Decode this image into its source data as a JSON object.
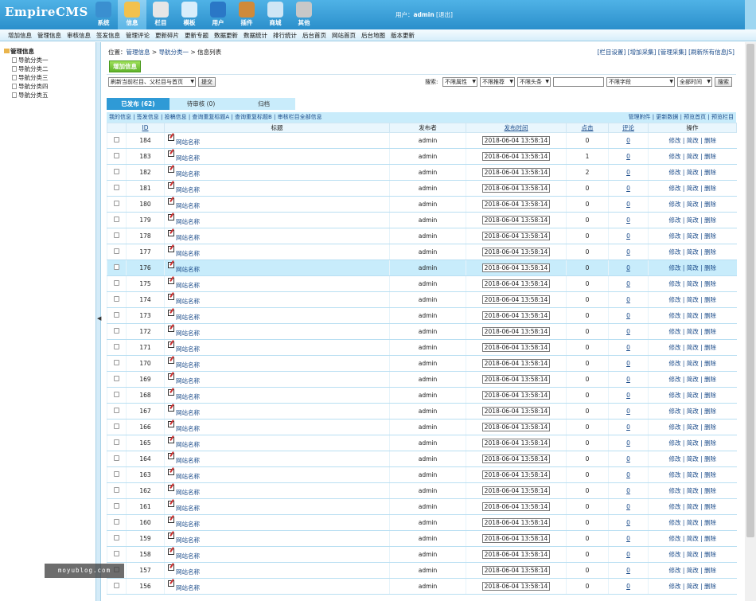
{
  "header": {
    "logo_text": "EmpireCMS",
    "nav": [
      {
        "label": "系统",
        "icon": "globe-icon",
        "color": "#3a8fd0"
      },
      {
        "label": "信息",
        "icon": "edit-note-icon",
        "color": "#f2c14e"
      },
      {
        "label": "栏目",
        "icon": "folder-icon",
        "color": "#e6e6e6"
      },
      {
        "label": "模板",
        "icon": "template-window-icon",
        "color": "#d8eefb"
      },
      {
        "label": "用户",
        "icon": "user-icon",
        "color": "#2a77c6"
      },
      {
        "label": "插件",
        "icon": "tools-icon",
        "color": "#d08a3a"
      },
      {
        "label": "商城",
        "icon": "shop-card-icon",
        "color": "#cfe6f5"
      },
      {
        "label": "其他",
        "icon": "gear-icon",
        "color": "#c8c8c8"
      }
    ],
    "active_nav": 1,
    "user_prefix": "用户：",
    "username": "admin",
    "logout": "[退出]"
  },
  "subnav": [
    "增加信息",
    "管理信息",
    "审核信息",
    "签发信息",
    "管理评论",
    "更新碎片",
    "更新专题",
    "数据更新",
    "数据统计",
    "排行统计",
    "后台首页",
    "网站首页",
    "后台地图",
    "版本更新"
  ],
  "sidebar": {
    "root": "管理信息",
    "items": [
      "导航分类一",
      "导航分类二",
      "导航分类三",
      "导航分类四",
      "导航分类五"
    ]
  },
  "breadcrumb": {
    "prefix": "位置：",
    "part1": "管理信息",
    "sep": " > ",
    "part2": "导航分类一",
    "part3": "信息列表"
  },
  "top_links": "[栏目设置] [增加采集] [管理采集] [刷新所有信息JS]",
  "add_button": "增加信息",
  "toolbar": {
    "refresh_select": "刷新当前栏目、父栏目与首页",
    "submit": "提交",
    "search_label": "搜索:",
    "attr_select": "不限属性",
    "recommend_select": "不限推荐",
    "headline_select": "不限头条",
    "field_select": "不限字段",
    "time_select": "全部时间",
    "search_button": "搜索"
  },
  "tabs": [
    {
      "label": "已发布 (62)"
    },
    {
      "label": "待审核 (0)"
    },
    {
      "label": "归档"
    }
  ],
  "linkbar": {
    "left": "我的信息 | 签发信息 | 投稿信息 | 查询重复标题A | 查询重复标题B | 审核栏目全部信息",
    "right": "管理附件 | 更新数据 | 预览首页 | 预览栏目"
  },
  "table": {
    "headers": {
      "id": "ID",
      "title": "标题",
      "publisher": "发布者",
      "time": "发布时间",
      "clicks": "点击",
      "comments": "评论",
      "ops": "操作"
    },
    "rows": [
      {
        "id": "184",
        "title": "网站名称",
        "publisher": "admin",
        "time": "2018-06-04 13:58:14",
        "clicks": "0",
        "comments": "0"
      },
      {
        "id": "183",
        "title": "网站名称",
        "publisher": "admin",
        "time": "2018-06-04 13:58:14",
        "clicks": "1",
        "comments": "0"
      },
      {
        "id": "182",
        "title": "网站名称",
        "publisher": "admin",
        "time": "2018-06-04 13:58:14",
        "clicks": "2",
        "comments": "0"
      },
      {
        "id": "181",
        "title": "网站名称",
        "publisher": "admin",
        "time": "2018-06-04 13:58:14",
        "clicks": "0",
        "comments": "0"
      },
      {
        "id": "180",
        "title": "网站名称",
        "publisher": "admin",
        "time": "2018-06-04 13:58:14",
        "clicks": "0",
        "comments": "0"
      },
      {
        "id": "179",
        "title": "网站名称",
        "publisher": "admin",
        "time": "2018-06-04 13:58:14",
        "clicks": "0",
        "comments": "0"
      },
      {
        "id": "178",
        "title": "网站名称",
        "publisher": "admin",
        "time": "2018-06-04 13:58:14",
        "clicks": "0",
        "comments": "0"
      },
      {
        "id": "177",
        "title": "网站名称",
        "publisher": "admin",
        "time": "2018-06-04 13:58:14",
        "clicks": "0",
        "comments": "0"
      },
      {
        "id": "176",
        "title": "网站名称",
        "publisher": "admin",
        "time": "2018-06-04 13:58:14",
        "clicks": "0",
        "comments": "0"
      },
      {
        "id": "175",
        "title": "网站名称",
        "publisher": "admin",
        "time": "2018-06-04 13:58:14",
        "clicks": "0",
        "comments": "0"
      },
      {
        "id": "174",
        "title": "网站名称",
        "publisher": "admin",
        "time": "2018-06-04 13:58:14",
        "clicks": "0",
        "comments": "0"
      },
      {
        "id": "173",
        "title": "网站名称",
        "publisher": "admin",
        "time": "2018-06-04 13:58:14",
        "clicks": "0",
        "comments": "0"
      },
      {
        "id": "172",
        "title": "网站名称",
        "publisher": "admin",
        "time": "2018-06-04 13:58:14",
        "clicks": "0",
        "comments": "0"
      },
      {
        "id": "171",
        "title": "网站名称",
        "publisher": "admin",
        "time": "2018-06-04 13:58:14",
        "clicks": "0",
        "comments": "0"
      },
      {
        "id": "170",
        "title": "网站名称",
        "publisher": "admin",
        "time": "2018-06-04 13:58:14",
        "clicks": "0",
        "comments": "0"
      },
      {
        "id": "169",
        "title": "网站名称",
        "publisher": "admin",
        "time": "2018-06-04 13:58:14",
        "clicks": "0",
        "comments": "0"
      },
      {
        "id": "168",
        "title": "网站名称",
        "publisher": "admin",
        "time": "2018-06-04 13:58:14",
        "clicks": "0",
        "comments": "0"
      },
      {
        "id": "167",
        "title": "网站名称",
        "publisher": "admin",
        "time": "2018-06-04 13:58:14",
        "clicks": "0",
        "comments": "0"
      },
      {
        "id": "166",
        "title": "网站名称",
        "publisher": "admin",
        "time": "2018-06-04 13:58:14",
        "clicks": "0",
        "comments": "0"
      },
      {
        "id": "165",
        "title": "网站名称",
        "publisher": "admin",
        "time": "2018-06-04 13:58:14",
        "clicks": "0",
        "comments": "0"
      },
      {
        "id": "164",
        "title": "网站名称",
        "publisher": "admin",
        "time": "2018-06-04 13:58:14",
        "clicks": "0",
        "comments": "0"
      },
      {
        "id": "163",
        "title": "网站名称",
        "publisher": "admin",
        "time": "2018-06-04 13:58:14",
        "clicks": "0",
        "comments": "0"
      },
      {
        "id": "162",
        "title": "网站名称",
        "publisher": "admin",
        "time": "2018-06-04 13:58:14",
        "clicks": "0",
        "comments": "0"
      },
      {
        "id": "161",
        "title": "网站名称",
        "publisher": "admin",
        "time": "2018-06-04 13:58:14",
        "clicks": "0",
        "comments": "0"
      },
      {
        "id": "160",
        "title": "网站名称",
        "publisher": "admin",
        "time": "2018-06-04 13:58:14",
        "clicks": "0",
        "comments": "0"
      },
      {
        "id": "159",
        "title": "网站名称",
        "publisher": "admin",
        "time": "2018-06-04 13:58:14",
        "clicks": "0",
        "comments": "0"
      },
      {
        "id": "158",
        "title": "网站名称",
        "publisher": "admin",
        "time": "2018-06-04 13:58:14",
        "clicks": "0",
        "comments": "0"
      },
      {
        "id": "157",
        "title": "网站名称",
        "publisher": "admin",
        "time": "2018-06-04 13:58:14",
        "clicks": "0",
        "comments": "0"
      },
      {
        "id": "156",
        "title": "网站名称",
        "publisher": "admin",
        "time": "2018-06-04 13:58:14",
        "clicks": "0",
        "comments": "0"
      }
    ],
    "highlight_id": "176",
    "ops": {
      "edit": "修改",
      "quick_edit": "简改",
      "delete": "删除",
      "sep": " | "
    }
  },
  "watermark": "moyublog.com",
  "colors": {
    "header": "#2b8fcb",
    "tab_active": "#2f9ad6",
    "tab_light": "#c9ecfb",
    "link": "#1a4b8a",
    "row_highlight": "#c8ecfb"
  }
}
